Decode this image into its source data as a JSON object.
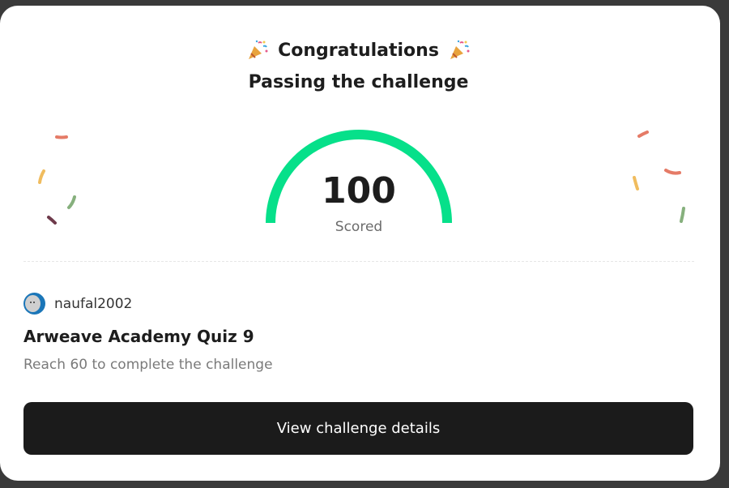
{
  "header": {
    "title": "Congratulations",
    "subtitle": "Passing the challenge",
    "icon": "party-popper-icon"
  },
  "score": {
    "value": "100",
    "label": "Scored",
    "fraction": 1.0,
    "color": "#06e08a"
  },
  "user": {
    "name": "naufal2002",
    "avatar_color": "#1b76b8"
  },
  "challenge": {
    "title": "Arweave Academy Quiz 9",
    "requirement": "Reach 60 to complete the challenge"
  },
  "actions": {
    "view_details_label": "View challenge details"
  },
  "colors": {
    "background": "#3a3a3a",
    "card": "#ffffff",
    "button": "#1b1b1b",
    "confetti_red": "#e57b67",
    "confetti_yellow": "#f0bc5e",
    "confetti_green": "#86b07d",
    "confetti_maroon": "#6e3a4b"
  }
}
